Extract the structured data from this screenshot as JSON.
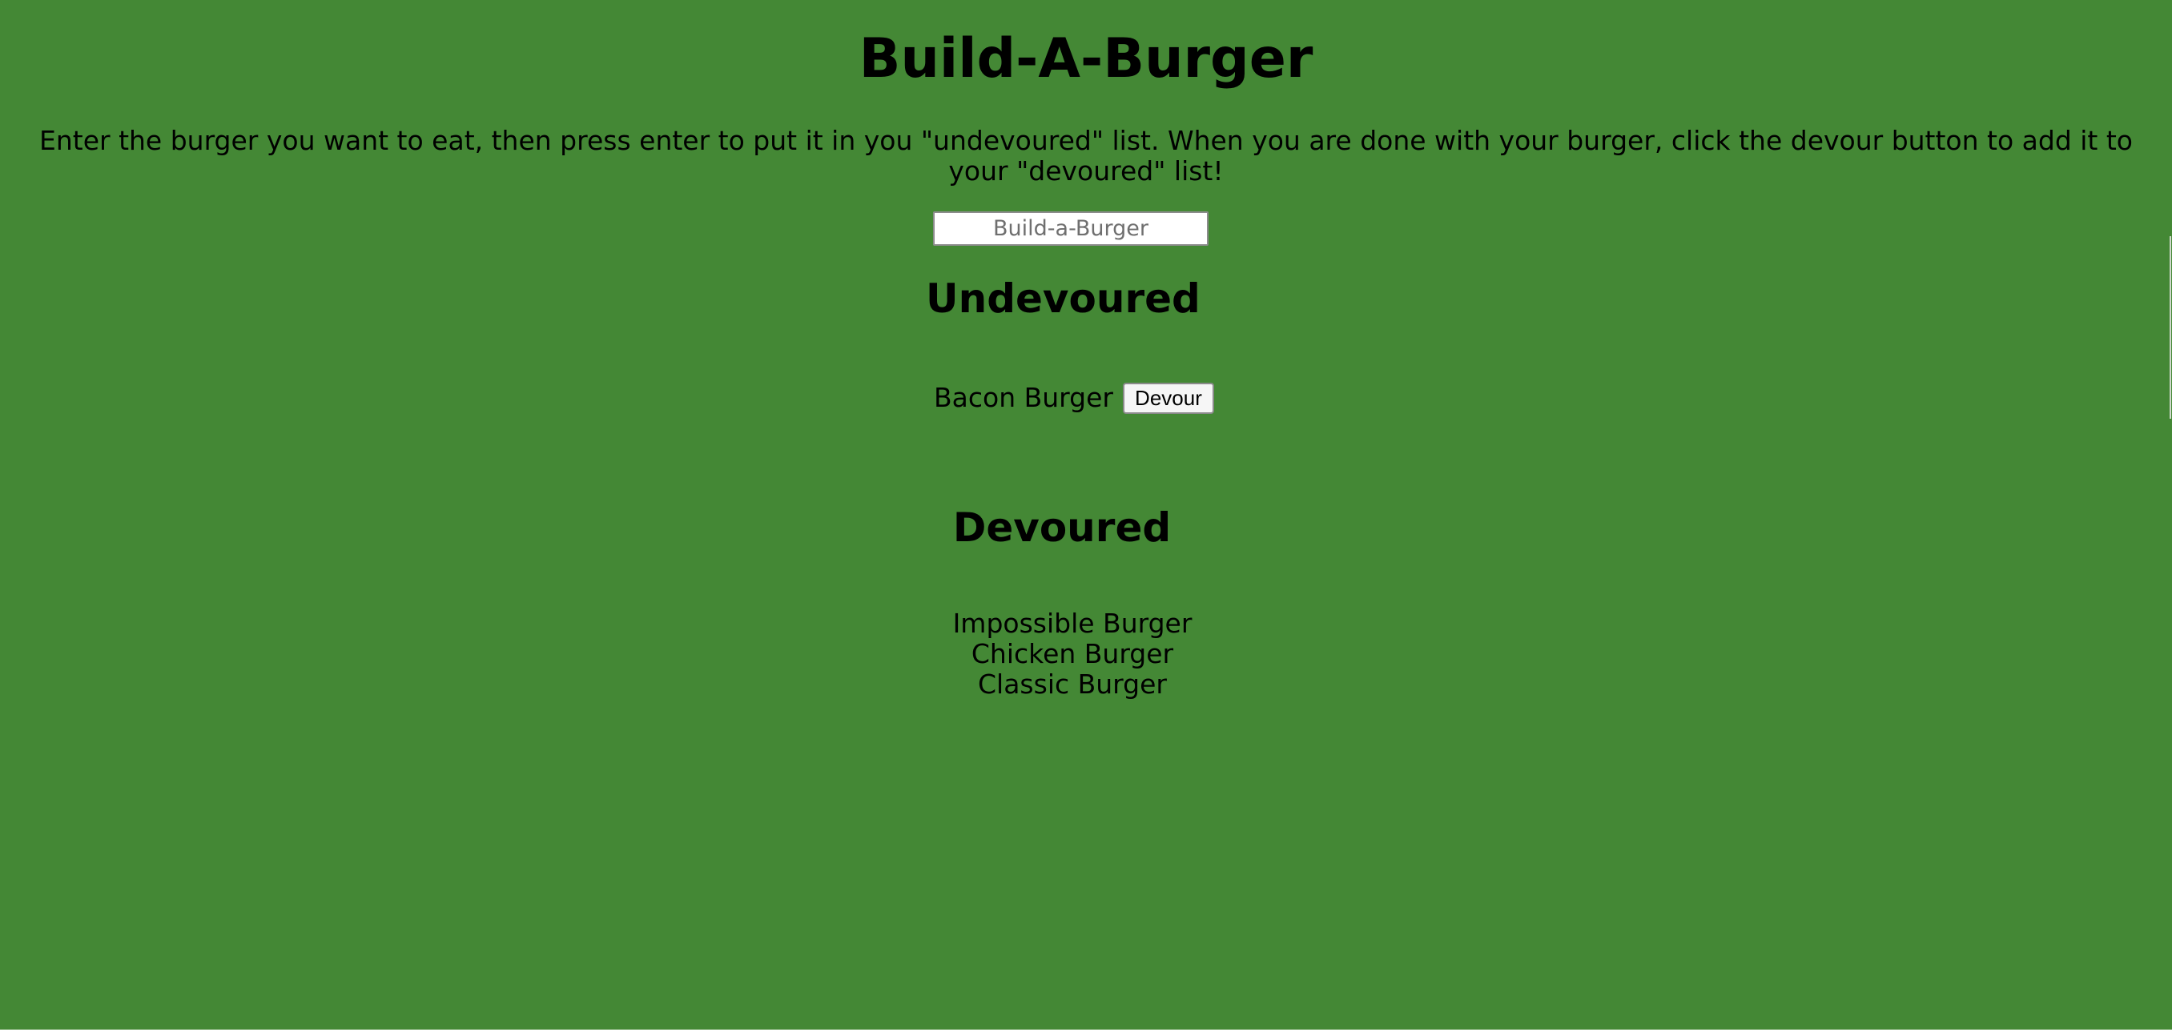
{
  "page": {
    "title": "Build-A-Burger",
    "intro": "Enter the burger you want to eat, then press enter to put it in you \"undevoured\" list. When you are done with your burger, click the devour button to add it to your \"devoured\" list!",
    "background_color": "#448835"
  },
  "form": {
    "placeholder": "Build-a-Burger",
    "value": ""
  },
  "undevoured": {
    "heading": "Undevoured",
    "items": [
      {
        "name": "Bacon Burger",
        "button_label": "Devour"
      }
    ]
  },
  "devoured": {
    "heading": "Devoured",
    "items": [
      "Impossible Burger",
      "Chicken Burger",
      "Classic Burger"
    ]
  }
}
